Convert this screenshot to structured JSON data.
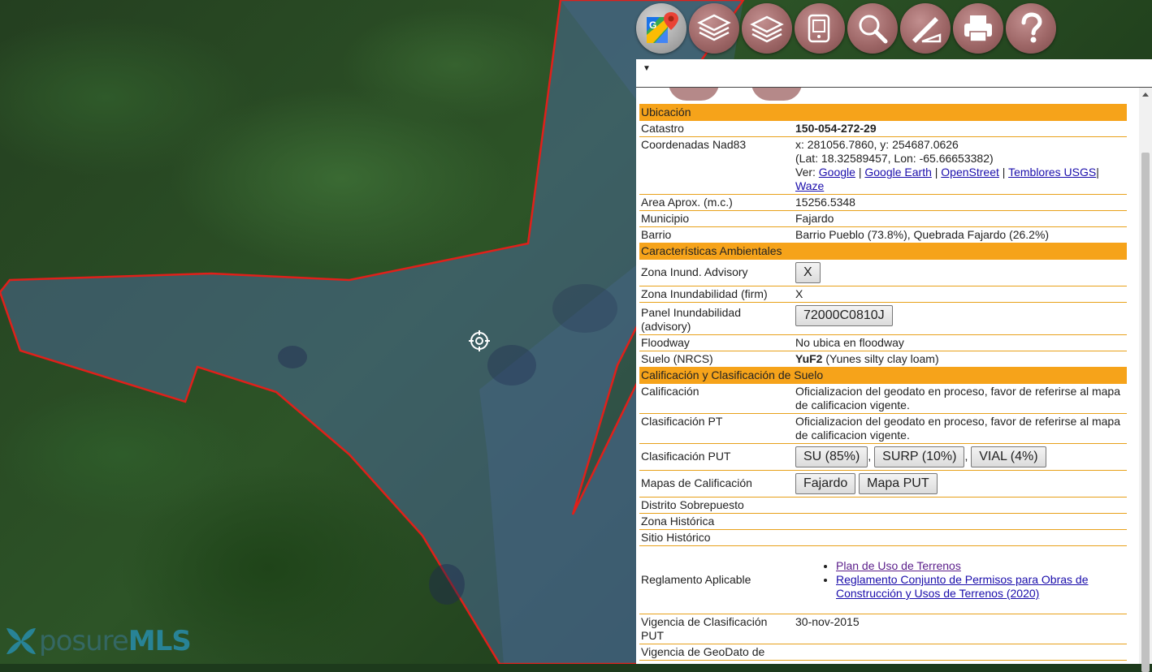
{
  "map": {
    "logo_part1": "posure",
    "logo_part2": "MLS"
  },
  "toolbar": [
    {
      "name": "google-maps-icon"
    },
    {
      "name": "layers-icon"
    },
    {
      "name": "layers-alt-icon"
    },
    {
      "name": "device-icon"
    },
    {
      "name": "search-icon"
    },
    {
      "name": "measure-icon"
    },
    {
      "name": "print-icon"
    },
    {
      "name": "help-icon"
    }
  ],
  "panel": {
    "caret": "▼",
    "sections": {
      "ubicacion": "Ubicación",
      "ambientales": "Características Ambientales",
      "calificacion": "Calificación y Clasificación de Suelo"
    },
    "catastro": {
      "label": "Catastro",
      "value": "150-054-272-29"
    },
    "coords": {
      "label": "Coordenadas Nad83",
      "xy": "x: 281056.7860, y: 254687.0626",
      "latlon": "(Lat: 18.32589457, Lon: -65.66653382)",
      "ver": "Ver:",
      "link_google": "Google",
      "link_earth": "Google Earth",
      "link_osm": "OpenStreet",
      "link_usgs": "Temblores USGS",
      "link_waze": "Waze"
    },
    "area": {
      "label": "Area Aprox. (m.c.)",
      "value": "15256.5348"
    },
    "municipio": {
      "label": "Municipio",
      "value": "Fajardo"
    },
    "barrio": {
      "label": "Barrio",
      "value": "Barrio Pueblo (73.8%), Quebrada Fajardo (26.2%)"
    },
    "zona_advisory": {
      "label": "Zona Inund. Advisory",
      "button": "X"
    },
    "zona_firm": {
      "label": "Zona Inundabilidad (firm)",
      "value": "X"
    },
    "panel_inund": {
      "label": "Panel Inundabilidad (advisory)",
      "button": "72000C0810J"
    },
    "floodway": {
      "label": "Floodway",
      "value": "No ubica en floodway"
    },
    "suelo": {
      "label": "Suelo (NRCS)",
      "code": "YuF2",
      "desc": " (Yunes silty clay loam)"
    },
    "calificacion": {
      "label": "Calificación",
      "value": "Oficializacion del geodato en proceso, favor de referirse al mapa de calificacion vigente."
    },
    "clasif_pt": {
      "label": "Clasificación PT",
      "value": "Oficializacion del geodato en proceso, favor de referirse al mapa de calificacion vigente."
    },
    "clasif_put": {
      "label": "Clasificación PUT",
      "buttons": [
        "SU (85%)",
        "SURP (10%)",
        "VIAL (4%)"
      ]
    },
    "mapas": {
      "label": "Mapas de Calificación",
      "buttons": [
        "Fajardo",
        "Mapa PUT"
      ]
    },
    "distrito": {
      "label": "Distrito Sobrepuesto"
    },
    "zona_hist": {
      "label": "Zona Histórica"
    },
    "sitio_hist": {
      "label": "Sitio Histórico"
    },
    "reglamento": {
      "label": "Reglamento Aplicable",
      "links": [
        "Plan de Uso de Terrenos",
        "Reglamento Conjunto de Permisos para Obras de Construcción y Usos de Terrenos (2020)"
      ]
    },
    "vigencia": {
      "label": "Vigencia de Clasificación PUT",
      "value": "30-nov-2015"
    },
    "vigencia_geo": {
      "label": "Vigencia de GeoDato de"
    }
  }
}
